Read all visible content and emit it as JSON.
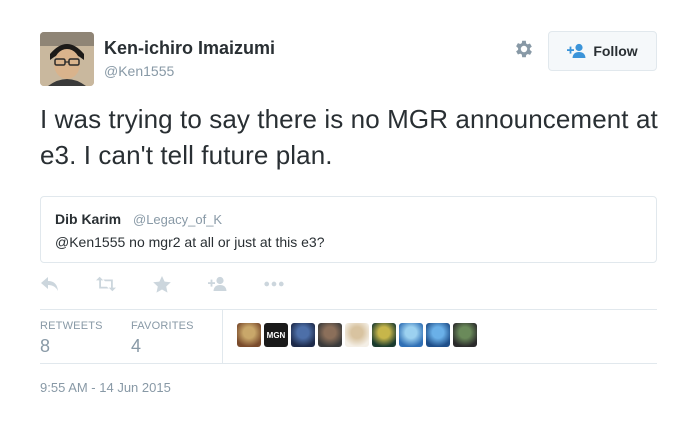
{
  "author": {
    "name": "Ken-ichiro Imaizumi",
    "handle": "@Ken1555"
  },
  "follow_button": {
    "label": "Follow"
  },
  "tweet": {
    "text": "I was trying to say there is no MGR announcement at e3. I can't tell future plan."
  },
  "quoted_tweet": {
    "name": "Dib Karim",
    "handle": "@Legacy_of_K",
    "text": "@Ken1555 no mgr2 at all or just at this e3?"
  },
  "actions": [
    {
      "name": "reply-icon"
    },
    {
      "name": "retweet-icon"
    },
    {
      "name": "favorite-icon"
    },
    {
      "name": "follow-icon"
    },
    {
      "name": "more-icon"
    }
  ],
  "stats": {
    "retweets_label": "RETWEETS",
    "retweets_value": "8",
    "favorites_label": "FAVORITES",
    "favorites_value": "4"
  },
  "favoriters": [
    {
      "name": "favoriter-avatar-1",
      "colors": [
        "#7a4b2c",
        "#c9a76a"
      ]
    },
    {
      "name": "favoriter-avatar-mgn",
      "text": "MGN",
      "colors": [
        "#1a1a1a",
        "#ffffff"
      ]
    },
    {
      "name": "favoriter-avatar-3",
      "colors": [
        "#1d2a4a",
        "#4d6fa8"
      ]
    },
    {
      "name": "favoriter-avatar-4",
      "colors": [
        "#3a3a3a",
        "#8b6f5a"
      ]
    },
    {
      "name": "favoriter-avatar-5",
      "colors": [
        "#f4efe6",
        "#d8c3a0"
      ]
    },
    {
      "name": "favoriter-avatar-6",
      "colors": [
        "#1b3b2e",
        "#c7b64a"
      ]
    },
    {
      "name": "favoriter-avatar-7",
      "colors": [
        "#2f6fb5",
        "#9cd1f0"
      ]
    },
    {
      "name": "favoriter-avatar-8",
      "colors": [
        "#1f4f8a",
        "#6ab0e8"
      ]
    },
    {
      "name": "favoriter-avatar-9",
      "colors": [
        "#2b2b2b",
        "#6a8a5a"
      ]
    }
  ],
  "timestamp": "9:55 AM - 14 Jun 2015"
}
